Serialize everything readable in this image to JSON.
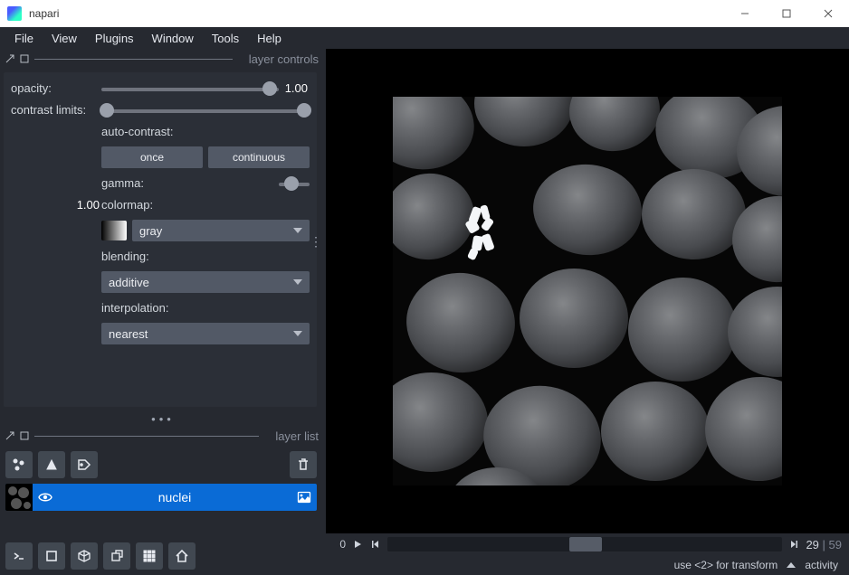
{
  "title": "napari",
  "menu": [
    "File",
    "View",
    "Plugins",
    "Window",
    "Tools",
    "Help"
  ],
  "panels": {
    "controls": "layer controls",
    "list": "layer list"
  },
  "controls": {
    "opacity": {
      "label": "opacity:",
      "value": "1.00",
      "pos": 0.95
    },
    "contrast": {
      "label": "contrast limits:",
      "low": 0.0,
      "high": 1.0
    },
    "auto": {
      "label": "auto-contrast:",
      "once": "once",
      "continuous": "continuous"
    },
    "gamma": {
      "label": "gamma:",
      "value": "1.00",
      "pos": 0.42
    },
    "colormap": {
      "label": "colormap:",
      "value": "gray"
    },
    "blending": {
      "label": "blending:",
      "value": "additive"
    },
    "interpolation": {
      "label": "interpolation:",
      "value": "nearest"
    }
  },
  "layer": {
    "name": "nuclei"
  },
  "timeline": {
    "axis": "0",
    "current": "29",
    "total": "59"
  },
  "status": {
    "hint": "use <2> for transform",
    "activity": "activity"
  }
}
